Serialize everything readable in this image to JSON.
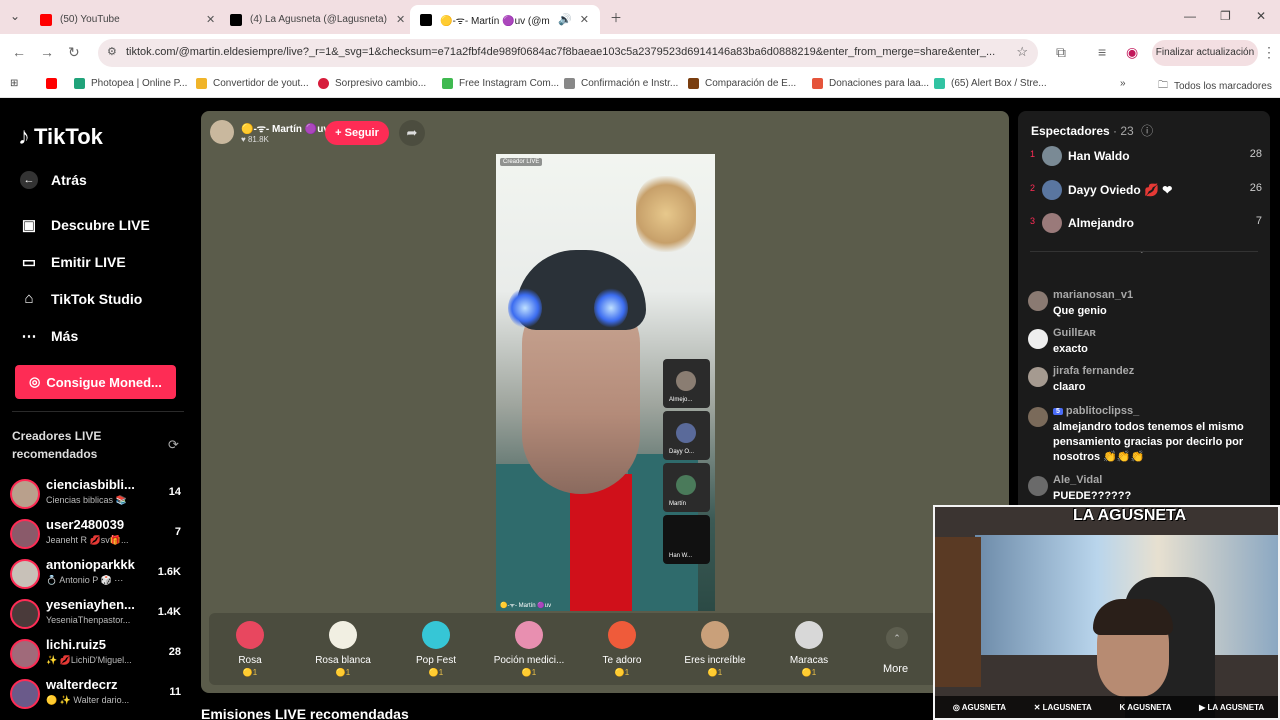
{
  "browser": {
    "tabs": [
      {
        "title": "(50) YouTube",
        "color": "#ff0000"
      },
      {
        "title": "(4) La Agusneta (@Lagusneta) /",
        "color": "#000000"
      },
      {
        "title": "🟡-ᯤ- Martín 🟣uv (@mar",
        "color": "#000000"
      }
    ],
    "url": "tiktok.com/@martin.eldesiempre/live?_r=1&_svg=1&checksum=e71a2fbf4de989f0684ac7f8baeae103c5a2379523d6914146a83ba6d0888219&enter_from_merge=share&enter_...",
    "update_label": "Finalizar actualización",
    "bookmarks": [
      "Photopea | Online P...",
      "Convertidor de yout...",
      "Sorpresivo cambio...",
      "Free Instagram Com...",
      "Confirmación e Instr...",
      "Comparación de E...",
      "Donaciones para laa...",
      "(65) Alert Box / Stre..."
    ],
    "all_bookmarks": "Todos los marcadores"
  },
  "sidebar": {
    "logo": "TikTok",
    "back": "Atrás",
    "items": [
      "Descubre LIVE",
      "Emitir LIVE",
      "TikTok Studio",
      "Más"
    ],
    "coins_button": "Consigue Moned...",
    "recommended_title": "Creadores LIVE recomendados",
    "creators": [
      {
        "name": "cienciasbibli...",
        "sub": "Ciencias biblicas 📚",
        "count": "14"
      },
      {
        "name": "user2480039",
        "sub": "Jeaneht R 💋sv🎁...",
        "count": "7"
      },
      {
        "name": "antonioparkkk",
        "sub": "💍 Antonio P 🎲 ⋯",
        "count": "1.6K"
      },
      {
        "name": "yeseniayhen...",
        "sub": "YeseniaThenpastor...",
        "count": "1.4K"
      },
      {
        "name": "lichi.ruiz5",
        "sub": "✨ 💋LichiD'Miguel...",
        "count": "28"
      },
      {
        "name": "walterdecrz",
        "sub": "🟡 ✨ Walter dario...",
        "count": "11"
      }
    ]
  },
  "live": {
    "host_name": "🟡-ᯤ- Martín 🟣uv",
    "host_likes": "♥ 81.8K",
    "follow_label": "+ Seguir",
    "video_badge": "Creador LIVE",
    "video_footer": "🟡-ᯤ- Martín 🟣uv",
    "guests": [
      "Almejo...",
      "Dayy O...",
      "Martín",
      "Han W..."
    ],
    "gifts": [
      {
        "name": "Rosa",
        "price": "🟡1",
        "color": "#e8475f"
      },
      {
        "name": "Rosa blanca",
        "price": "🟡1",
        "color": "#f1efe2"
      },
      {
        "name": "Pop Fest",
        "price": "🟡1",
        "color": "#36c6d6"
      },
      {
        "name": "Poción medici...",
        "price": "🟡1",
        "color": "#e88fb0"
      },
      {
        "name": "Te adoro",
        "price": "🟡1",
        "color": "#ef5b3a"
      },
      {
        "name": "Eres increíble",
        "price": "🟡1",
        "color": "#c9a07a"
      },
      {
        "name": "Maracas",
        "price": "🟡1",
        "color": "#d8d8d8"
      }
    ],
    "more_label": "More",
    "recommended_section": "Emisiones LIVE recomendadas"
  },
  "viewers": {
    "title": "Espectadores",
    "count": "· 23",
    "top": [
      {
        "rank": "1",
        "name": "Han Waldo",
        "score": "28"
      },
      {
        "rank": "2",
        "name": "Dayy Oviedo 💋 ❤",
        "score": "26"
      },
      {
        "rank": "3",
        "name": "Almejandro",
        "score": "7"
      }
    ]
  },
  "chat": [
    {
      "user": "marianosan_v1",
      "text": "Que genio",
      "level": ""
    },
    {
      "user": "Guillᴇᴀʀ",
      "text": "exacto",
      "level": ""
    },
    {
      "user": "jirafa fernandez",
      "text": "claaro",
      "level": ""
    },
    {
      "user": "pablitoclipss_",
      "text": "almejandro todos tenemos el mismo pensamiento gracias por decirlo por nosotros 👏👏👏",
      "level": "5"
    },
    {
      "user": "Ale_Vidal",
      "text": "PUEDE??????",
      "level": ""
    }
  ],
  "overlay": {
    "logo": "LA AGUSNETA",
    "socials": [
      "AGUSNETA",
      "LAGUSNETA",
      "AGUSNETA",
      "LA AGUSNETA"
    ]
  }
}
